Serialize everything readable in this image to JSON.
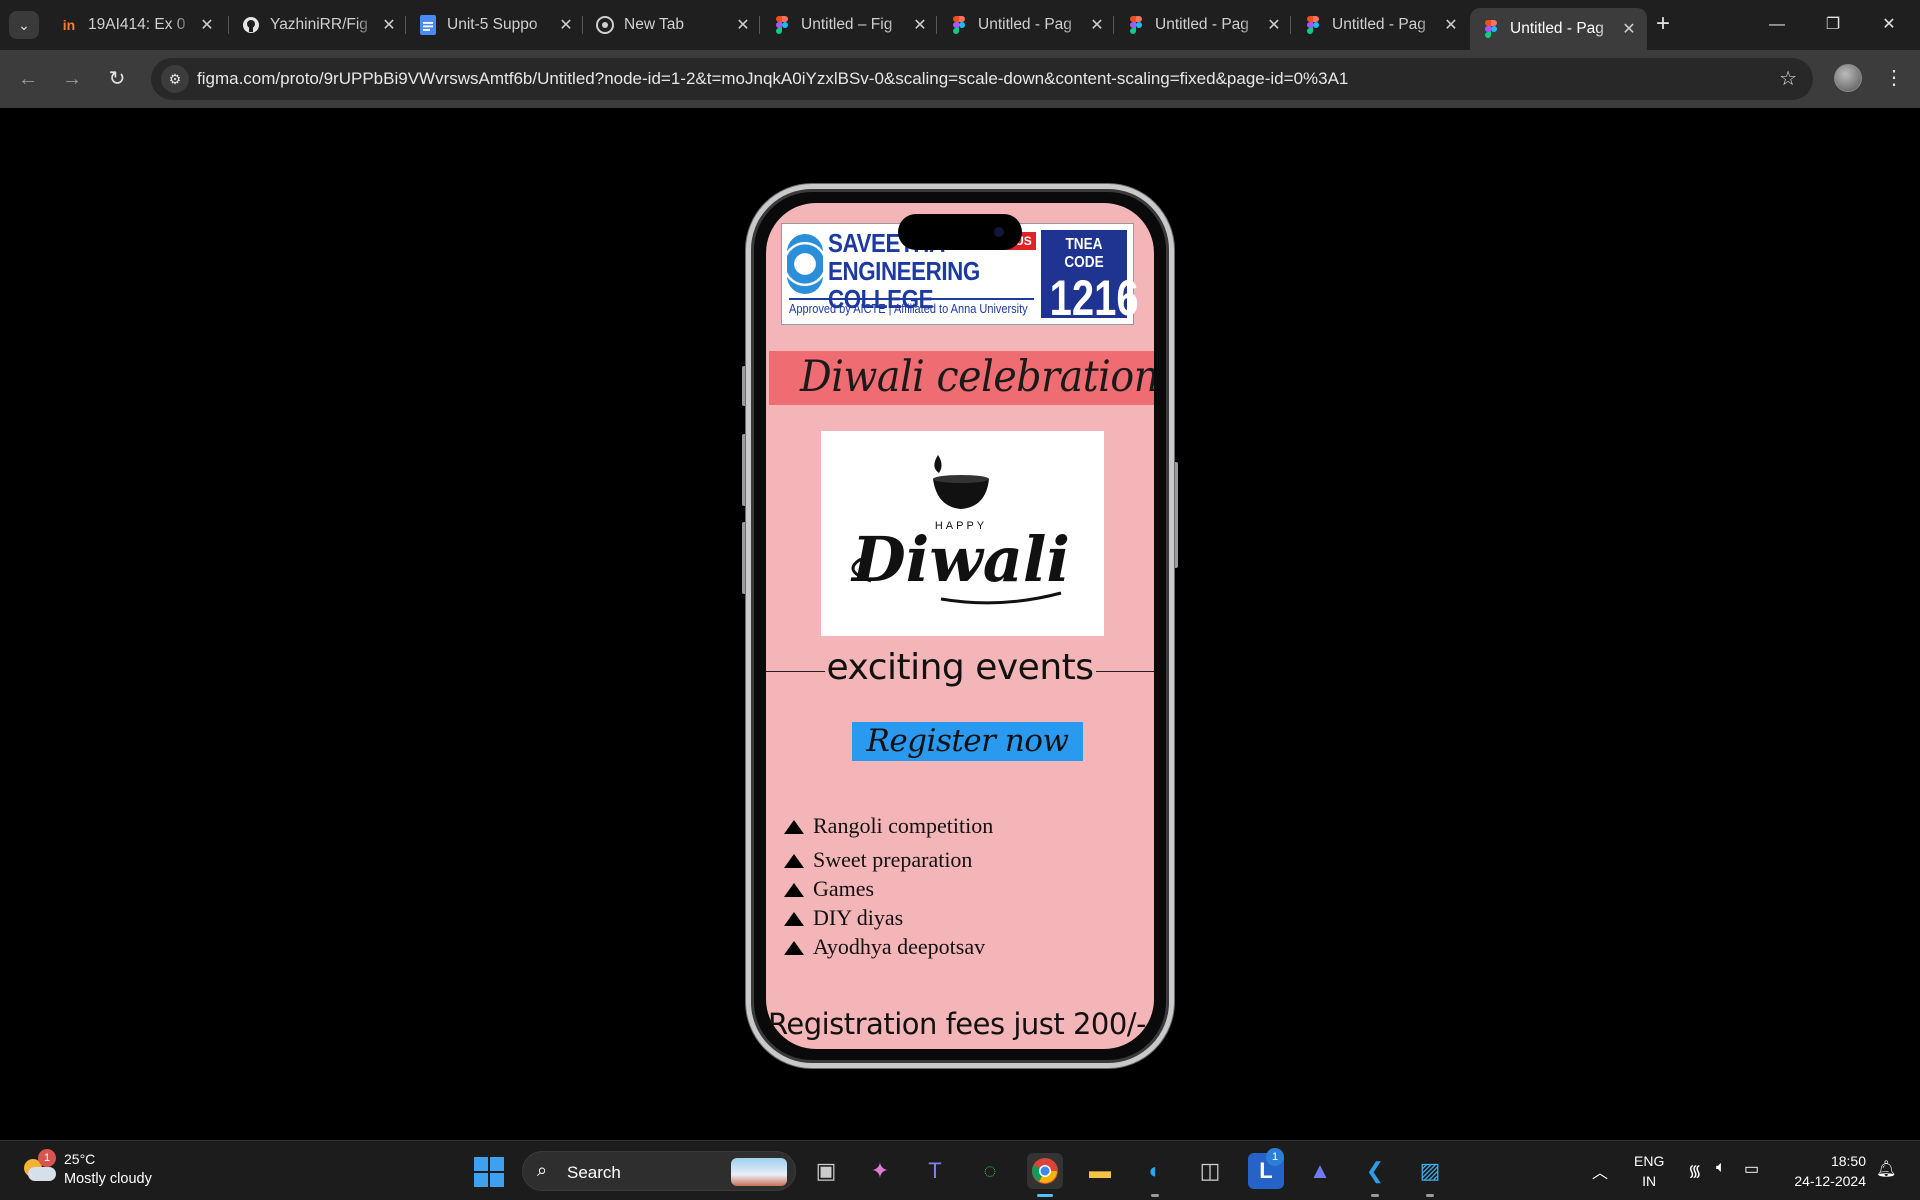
{
  "browser": {
    "tabs": [
      {
        "title": "19AI414: Ex 0",
        "icon": "invision-icon"
      },
      {
        "title": "YazhiniRR/Fig",
        "icon": "github-icon"
      },
      {
        "title": "Unit-5 Suppo",
        "icon": "google-docs-icon"
      },
      {
        "title": "New Tab",
        "icon": "chrome-icon"
      },
      {
        "title": "Untitled – Fig",
        "icon": "figma-icon"
      },
      {
        "title": "Untitled - Pag",
        "icon": "figma-icon"
      },
      {
        "title": "Untitled - Pag",
        "icon": "figma-icon"
      },
      {
        "title": "Untitled - Pag",
        "icon": "figma-icon"
      },
      {
        "title": "Untitled - Pag",
        "icon": "figma-icon",
        "active": true
      }
    ],
    "url": "figma.com/proto/9rUPPbBi9VWvrswsAmtf6b/Untitled?node-id=1-2&t=moJnqkA0iYzxlBSv-0&scaling=scale-down&content-scaling=fixed&page-id=0%3A1"
  },
  "prototype": {
    "college": {
      "name_line1": "SAVEETHA",
      "name_line2": "ENGINEERING COLLEGE",
      "autonomous_tag": "AUTONOMOUS",
      "approved": "Approved by AICTE  |  Affiliated to Anna University",
      "tnea_label": "TNEA CODE",
      "tnea_code": "1216"
    },
    "banner_title": "Diwali celebration",
    "image_text": {
      "small": "HAPPY",
      "large": "Diwali"
    },
    "events_heading": "exciting events",
    "register_label": "Register now",
    "events": [
      "Rangoli competition",
      "Sweet preparation",
      "Games",
      "DIY diyas",
      "Ayodhya deepotsav"
    ],
    "fees_text": "Registration fees just 200/-"
  },
  "taskbar": {
    "weather": {
      "temp": "25°C",
      "condition": "Mostly cloudy",
      "badge": "1"
    },
    "search_label": "Search",
    "lang_line1": "ENG",
    "lang_line2": "IN",
    "time": "18:50",
    "date": "24-12-2024",
    "notification_badge": "1"
  },
  "colors": {
    "screen_bg": "#f4b5b8",
    "banner_bg": "#f06c73",
    "register_bg": "#2a9af0",
    "college_blue": "#1d3aa0"
  }
}
